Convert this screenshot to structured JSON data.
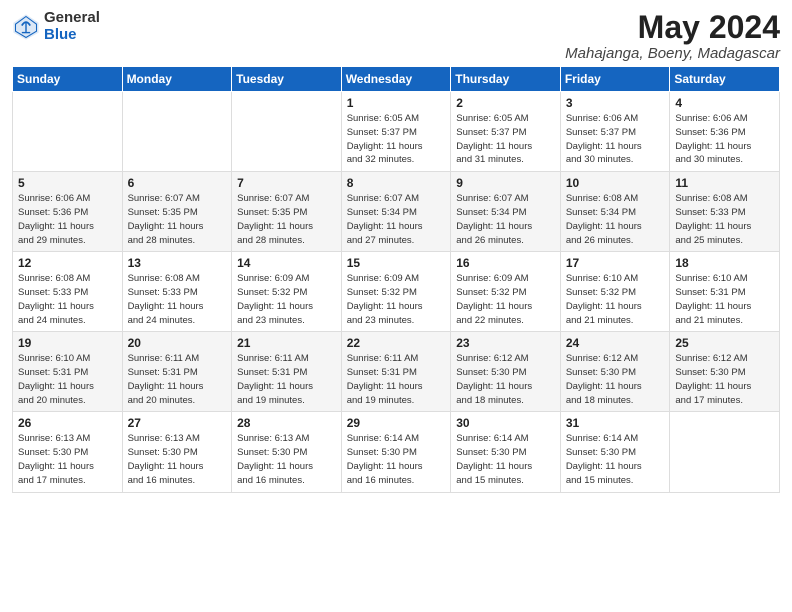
{
  "header": {
    "logo_general": "General",
    "logo_blue": "Blue",
    "title": "May 2024",
    "location": "Mahajanga, Boeny, Madagascar"
  },
  "weekdays": [
    "Sunday",
    "Monday",
    "Tuesday",
    "Wednesday",
    "Thursday",
    "Friday",
    "Saturday"
  ],
  "weeks": [
    [
      {
        "day": "",
        "info": ""
      },
      {
        "day": "",
        "info": ""
      },
      {
        "day": "",
        "info": ""
      },
      {
        "day": "1",
        "info": "Sunrise: 6:05 AM\nSunset: 5:37 PM\nDaylight: 11 hours\nand 32 minutes."
      },
      {
        "day": "2",
        "info": "Sunrise: 6:05 AM\nSunset: 5:37 PM\nDaylight: 11 hours\nand 31 minutes."
      },
      {
        "day": "3",
        "info": "Sunrise: 6:06 AM\nSunset: 5:37 PM\nDaylight: 11 hours\nand 30 minutes."
      },
      {
        "day": "4",
        "info": "Sunrise: 6:06 AM\nSunset: 5:36 PM\nDaylight: 11 hours\nand 30 minutes."
      }
    ],
    [
      {
        "day": "5",
        "info": "Sunrise: 6:06 AM\nSunset: 5:36 PM\nDaylight: 11 hours\nand 29 minutes."
      },
      {
        "day": "6",
        "info": "Sunrise: 6:07 AM\nSunset: 5:35 PM\nDaylight: 11 hours\nand 28 minutes."
      },
      {
        "day": "7",
        "info": "Sunrise: 6:07 AM\nSunset: 5:35 PM\nDaylight: 11 hours\nand 28 minutes."
      },
      {
        "day": "8",
        "info": "Sunrise: 6:07 AM\nSunset: 5:34 PM\nDaylight: 11 hours\nand 27 minutes."
      },
      {
        "day": "9",
        "info": "Sunrise: 6:07 AM\nSunset: 5:34 PM\nDaylight: 11 hours\nand 26 minutes."
      },
      {
        "day": "10",
        "info": "Sunrise: 6:08 AM\nSunset: 5:34 PM\nDaylight: 11 hours\nand 26 minutes."
      },
      {
        "day": "11",
        "info": "Sunrise: 6:08 AM\nSunset: 5:33 PM\nDaylight: 11 hours\nand 25 minutes."
      }
    ],
    [
      {
        "day": "12",
        "info": "Sunrise: 6:08 AM\nSunset: 5:33 PM\nDaylight: 11 hours\nand 24 minutes."
      },
      {
        "day": "13",
        "info": "Sunrise: 6:08 AM\nSunset: 5:33 PM\nDaylight: 11 hours\nand 24 minutes."
      },
      {
        "day": "14",
        "info": "Sunrise: 6:09 AM\nSunset: 5:32 PM\nDaylight: 11 hours\nand 23 minutes."
      },
      {
        "day": "15",
        "info": "Sunrise: 6:09 AM\nSunset: 5:32 PM\nDaylight: 11 hours\nand 23 minutes."
      },
      {
        "day": "16",
        "info": "Sunrise: 6:09 AM\nSunset: 5:32 PM\nDaylight: 11 hours\nand 22 minutes."
      },
      {
        "day": "17",
        "info": "Sunrise: 6:10 AM\nSunset: 5:32 PM\nDaylight: 11 hours\nand 21 minutes."
      },
      {
        "day": "18",
        "info": "Sunrise: 6:10 AM\nSunset: 5:31 PM\nDaylight: 11 hours\nand 21 minutes."
      }
    ],
    [
      {
        "day": "19",
        "info": "Sunrise: 6:10 AM\nSunset: 5:31 PM\nDaylight: 11 hours\nand 20 minutes."
      },
      {
        "day": "20",
        "info": "Sunrise: 6:11 AM\nSunset: 5:31 PM\nDaylight: 11 hours\nand 20 minutes."
      },
      {
        "day": "21",
        "info": "Sunrise: 6:11 AM\nSunset: 5:31 PM\nDaylight: 11 hours\nand 19 minutes."
      },
      {
        "day": "22",
        "info": "Sunrise: 6:11 AM\nSunset: 5:31 PM\nDaylight: 11 hours\nand 19 minutes."
      },
      {
        "day": "23",
        "info": "Sunrise: 6:12 AM\nSunset: 5:30 PM\nDaylight: 11 hours\nand 18 minutes."
      },
      {
        "day": "24",
        "info": "Sunrise: 6:12 AM\nSunset: 5:30 PM\nDaylight: 11 hours\nand 18 minutes."
      },
      {
        "day": "25",
        "info": "Sunrise: 6:12 AM\nSunset: 5:30 PM\nDaylight: 11 hours\nand 17 minutes."
      }
    ],
    [
      {
        "day": "26",
        "info": "Sunrise: 6:13 AM\nSunset: 5:30 PM\nDaylight: 11 hours\nand 17 minutes."
      },
      {
        "day": "27",
        "info": "Sunrise: 6:13 AM\nSunset: 5:30 PM\nDaylight: 11 hours\nand 16 minutes."
      },
      {
        "day": "28",
        "info": "Sunrise: 6:13 AM\nSunset: 5:30 PM\nDaylight: 11 hours\nand 16 minutes."
      },
      {
        "day": "29",
        "info": "Sunrise: 6:14 AM\nSunset: 5:30 PM\nDaylight: 11 hours\nand 16 minutes."
      },
      {
        "day": "30",
        "info": "Sunrise: 6:14 AM\nSunset: 5:30 PM\nDaylight: 11 hours\nand 15 minutes."
      },
      {
        "day": "31",
        "info": "Sunrise: 6:14 AM\nSunset: 5:30 PM\nDaylight: 11 hours\nand 15 minutes."
      },
      {
        "day": "",
        "info": ""
      }
    ]
  ]
}
